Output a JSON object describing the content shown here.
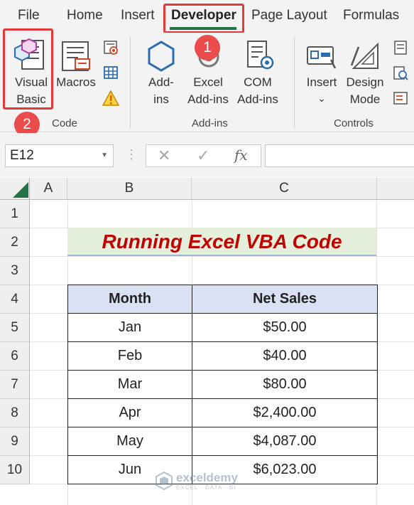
{
  "ribbon_tabs": [
    "File",
    "Home",
    "Insert",
    "Developer",
    "Page Layout",
    "Formulas"
  ],
  "active_tab": "Developer",
  "code_group": {
    "label": "Code",
    "visual_basic": [
      "Visual",
      "Basic"
    ],
    "macros": "Macros"
  },
  "addins_group": {
    "label": "Add-ins",
    "addins": [
      "Add-",
      "ins"
    ],
    "excel_addins": [
      "Excel",
      "Add-ins"
    ],
    "com_addins": [
      "COM",
      "Add-ins"
    ]
  },
  "controls_group": {
    "label": "Controls",
    "insert": "Insert",
    "design_mode": [
      "Design",
      "Mode"
    ]
  },
  "markers": [
    "1",
    "2"
  ],
  "formula_bar": {
    "name_box": "E12",
    "fx": "fx",
    "cancel": "✕",
    "enter": "✓"
  },
  "columns": [
    "A",
    "B",
    "C"
  ],
  "rows": [
    "1",
    "2",
    "3",
    "4",
    "5",
    "6",
    "7",
    "8",
    "9",
    "10"
  ],
  "sheet": {
    "title": "Running Excel VBA Code",
    "headers": [
      "Month",
      "Net Sales"
    ],
    "data": [
      [
        "Jan",
        "$50.00"
      ],
      [
        "Feb",
        "$40.00"
      ],
      [
        "Mar",
        "$80.00"
      ],
      [
        "Apr",
        "$2,400.00"
      ],
      [
        "May",
        "$4,087.00"
      ],
      [
        "Jun",
        "$6,023.00"
      ]
    ]
  },
  "watermark": {
    "name": "exceldemy",
    "tagline": "EXCEL · DATA · BI"
  },
  "colors": {
    "accent_green": "#217346",
    "highlight_red": "#e03a3a",
    "title_red": "#c00000",
    "header_fill": "#dae1f3"
  }
}
